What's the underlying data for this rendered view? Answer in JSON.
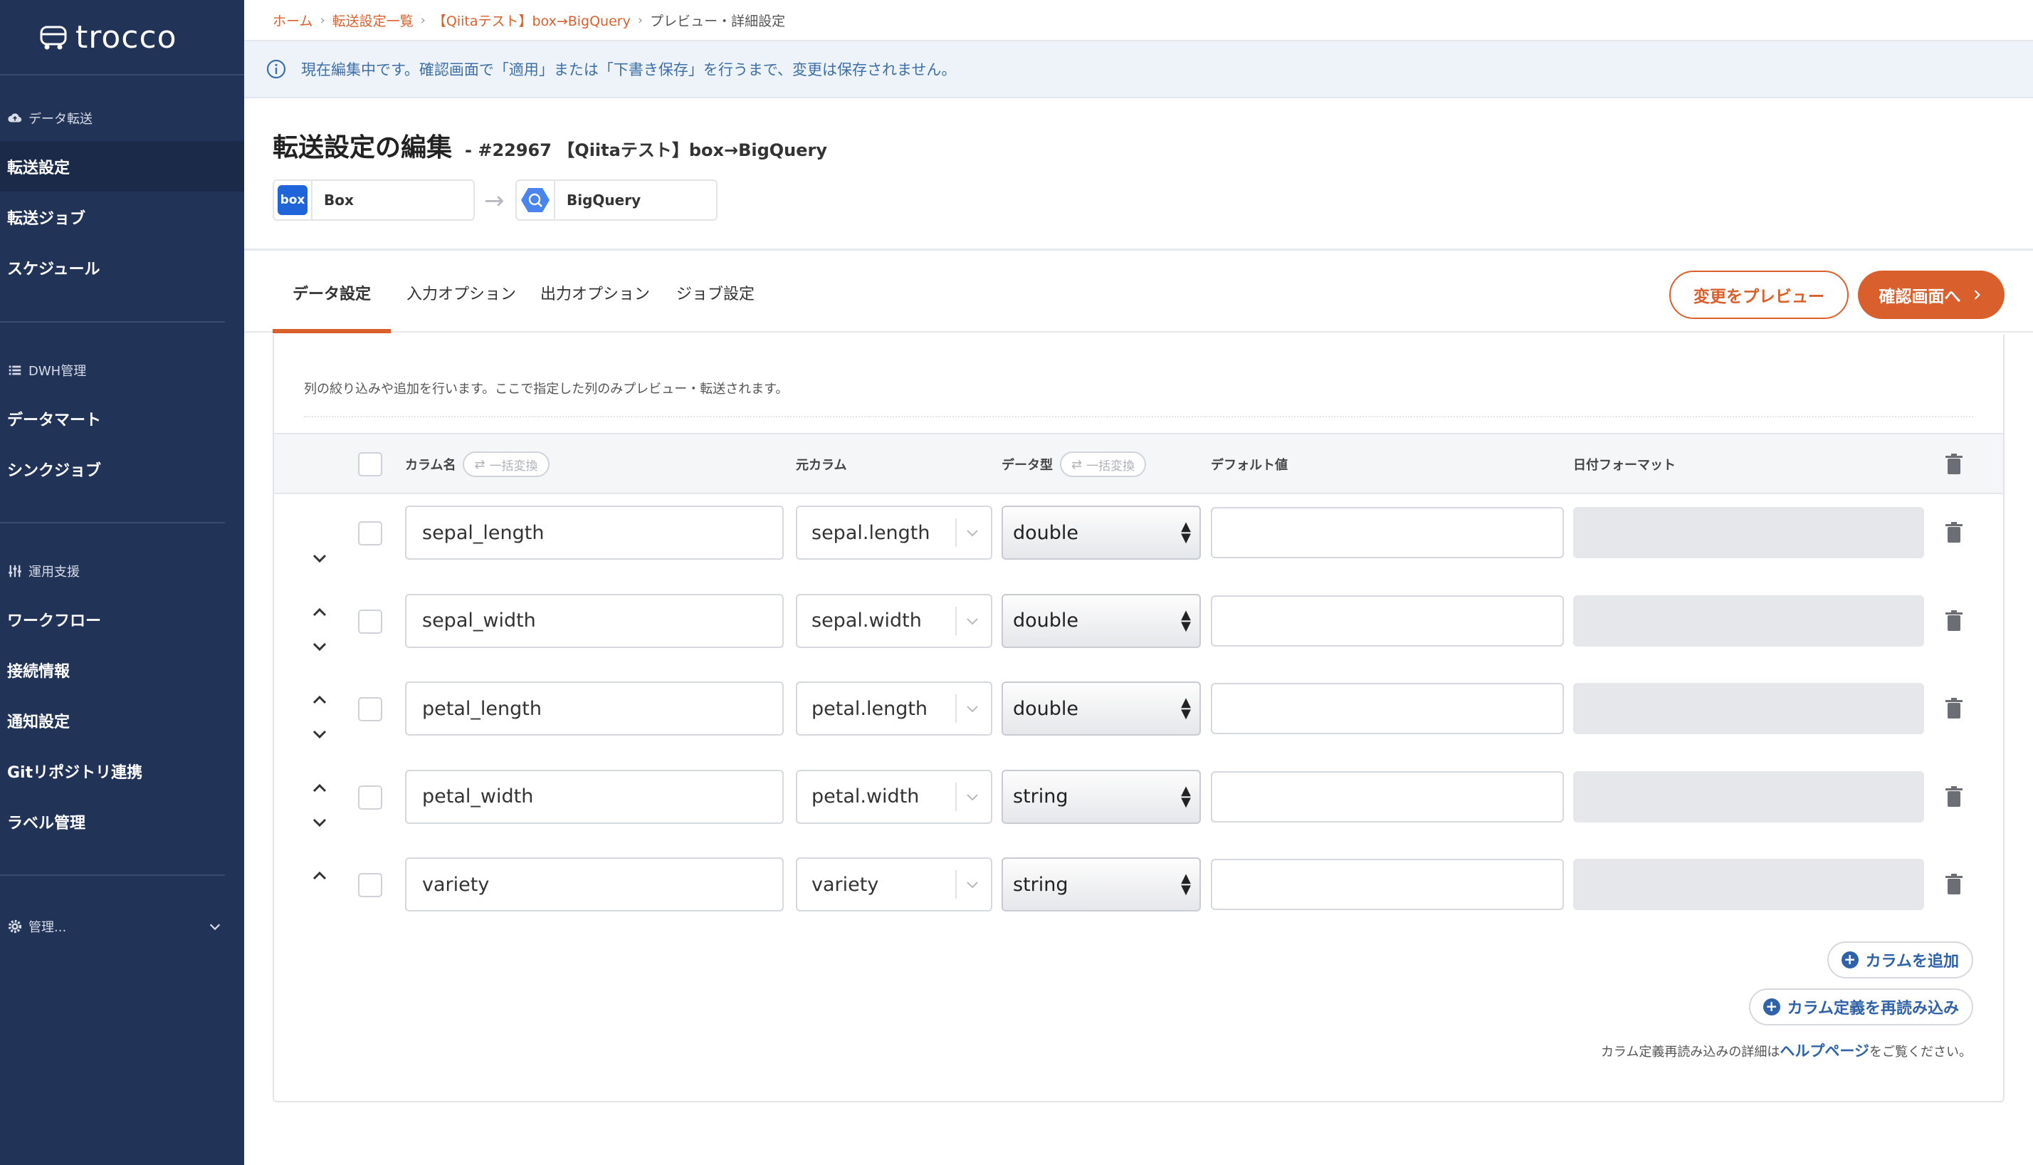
{
  "app": {
    "logo_text": "trocco"
  },
  "sidebar": {
    "sections": [
      {
        "title": "データ転送",
        "items": [
          "転送設定",
          "転送ジョブ",
          "スケジュール"
        ]
      },
      {
        "title": "DWH管理",
        "items": [
          "データマート",
          "シンクジョブ"
        ]
      },
      {
        "title": "運用支援",
        "items": [
          "ワークフロー",
          "接続情報",
          "通知設定",
          "Gitリポジトリ連携",
          "ラベル管理"
        ]
      }
    ],
    "manage_label": "管理..."
  },
  "breadcrumb": [
    "ホーム",
    "転送設定一覧",
    "【Qiitaテスト】box→BigQuery",
    "プレビュー・詳細設定"
  ],
  "notice": "現在編集中です。確認画面で「適用」または「下書き保存」を行うまで、変更は保存されません。",
  "page": {
    "title": "転送設定の編集",
    "subtitle": "- #22967 【Qiitaテスト】box→BigQuery",
    "source": {
      "name": "Box",
      "logo_text": "box"
    },
    "target": {
      "name": "BigQuery"
    }
  },
  "tabs": [
    "データ設定",
    "入力オプション",
    "出力オプション",
    "ジョブ設定"
  ],
  "buttons": {
    "preview": "変更をプレビュー",
    "confirm": "確認画面へ"
  },
  "table": {
    "description": "列の絞り込みや追加を行います。ここで指定した列のみプレビュー・転送されます。",
    "headers": {
      "column_name": "カラム名",
      "source_column": "元カラム",
      "data_type": "データ型",
      "default_value": "デフォルト値",
      "date_format": "日付フォーマット",
      "bulk_convert": "一括変換"
    },
    "rows": [
      {
        "name": "sepal_length",
        "source": "sepal.length",
        "type": "double",
        "default": ""
      },
      {
        "name": "sepal_width",
        "source": "sepal.width",
        "type": "double",
        "default": ""
      },
      {
        "name": "petal_length",
        "source": "petal.length",
        "type": "double",
        "default": ""
      },
      {
        "name": "petal_width",
        "source": "petal.width",
        "type": "string",
        "default": ""
      },
      {
        "name": "variety",
        "source": "variety",
        "type": "string",
        "default": ""
      }
    ],
    "add_column": "カラムを追加",
    "reload_columns": "カラム定義を再読み込み",
    "help_prefix": "カラム定義再読み込みの詳細は",
    "help_link": "ヘルプページ",
    "help_suffix": "をご覧ください。"
  }
}
